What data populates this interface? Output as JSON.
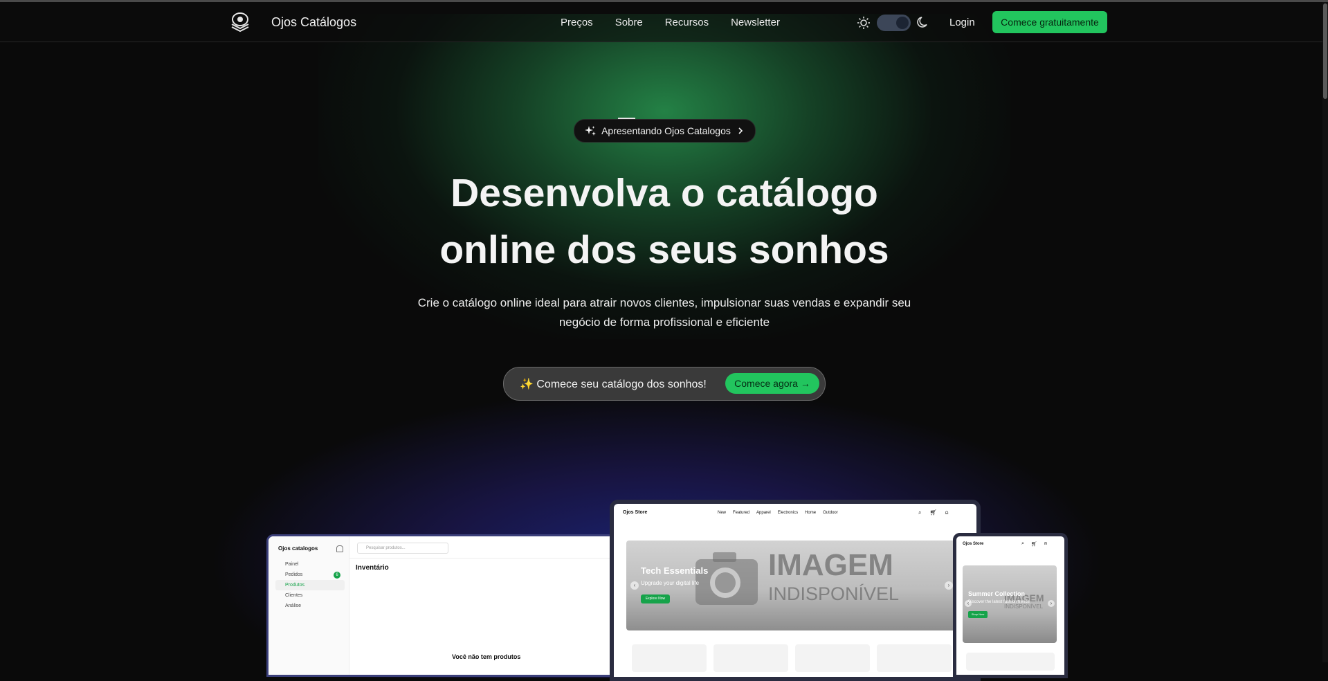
{
  "header": {
    "brand": "Ojos Catálogos",
    "nav": [
      "Preços",
      "Sobre",
      "Recursos",
      "Newsletter"
    ],
    "login": "Login",
    "cta": "Comece gratuitamente",
    "theme_toggle": "dark"
  },
  "hero": {
    "badge": "Apresentando Ojos Catalogos",
    "title_line1": "Desenvolva o catálogo",
    "title_line2": "online dos seus sonhos",
    "subtitle_line1": "Crie o catálogo online ideal para atrair novos clientes, impulsionar suas vendas e expandir seu",
    "subtitle_line2": "negócio de forma profissional e eficiente",
    "cta_text": "✨ Comece seu catálogo dos sonhos!",
    "cta_button": "Comece agora"
  },
  "dashboard_mock": {
    "brand": "Ojos catalogos",
    "search_placeholder": "Pesquisar produtos...",
    "menu": [
      "Painel",
      "Pedidos",
      "Produtos",
      "Clientes",
      "Análise"
    ],
    "orders_badge": "6",
    "section_title": "Inventário",
    "empty_message": "Você não tem produtos"
  },
  "store_mock": {
    "brand": "Ojos Store",
    "nav": [
      "New",
      "Featured",
      "Apparel",
      "Electronics",
      "Home",
      "Outdoor"
    ],
    "banner_title": "Tech Essentials",
    "banner_subtitle": "Upgrade your digital life",
    "banner_button": "Explore Now",
    "placeholder_line1": "IMAGEM",
    "placeholder_line2": "INDISPONÍVEL"
  },
  "phone_mock": {
    "brand": "Ojos Store",
    "banner_title": "Summer Collection",
    "banner_subtitle": "Discover the latest fashion trends",
    "banner_button": "Shop Now",
    "placeholder_line1": "IMAGEM",
    "placeholder_line2": "INDISPONÍVEL"
  },
  "colors": {
    "accent": "#22c55e",
    "background": "#0a0a0a"
  }
}
